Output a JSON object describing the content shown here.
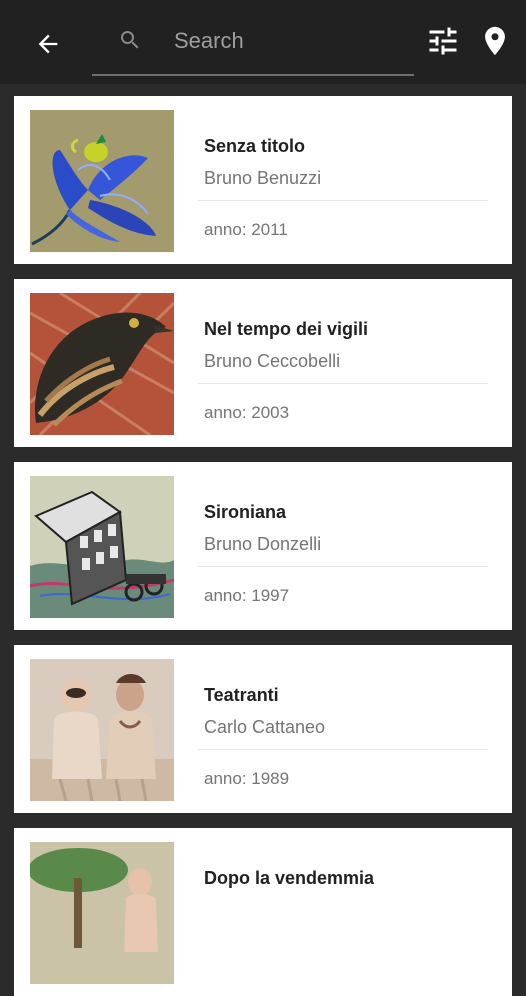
{
  "search": {
    "placeholder": "Search",
    "value": ""
  },
  "icons": {
    "back": "arrow-back-icon",
    "search": "search-icon",
    "filter": "tune-icon",
    "location": "location-pin-icon"
  },
  "colors": {
    "appbar": "#212121",
    "background": "#2b2b2b",
    "card": "#ffffff"
  },
  "artworks": [
    {
      "title": "Senza titolo",
      "artist": "Bruno Benuzzi",
      "year_label": "anno: 2011"
    },
    {
      "title": "Nel tempo dei vigili",
      "artist": "Bruno Ceccobelli",
      "year_label": "anno: 2003"
    },
    {
      "title": "Sironiana",
      "artist": "Bruno Donzelli",
      "year_label": "anno: 1997"
    },
    {
      "title": "Teatranti",
      "artist": "Carlo Cattaneo",
      "year_label": "anno: 1989"
    },
    {
      "title": "Dopo la vendemmia",
      "artist": "",
      "year_label": ""
    }
  ]
}
